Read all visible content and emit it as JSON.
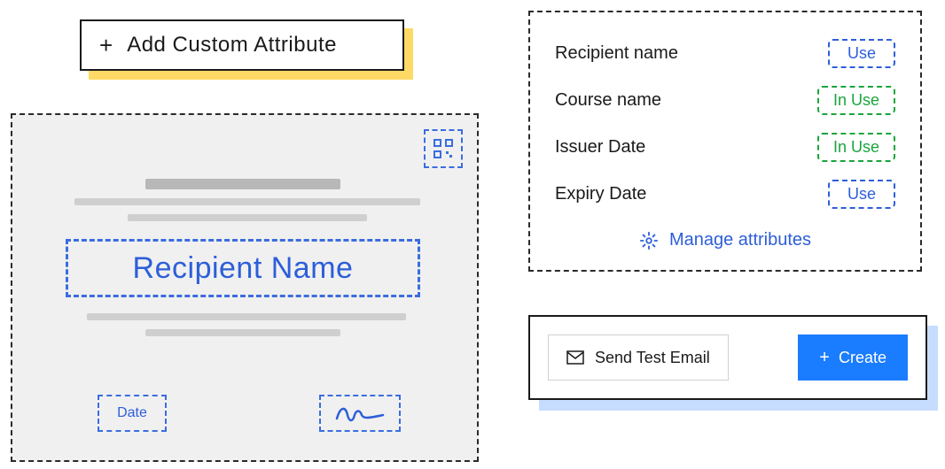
{
  "add_custom_attribute": {
    "label": "Add Custom Attribute"
  },
  "certificate": {
    "recipient_placeholder": "Recipient Name",
    "date_placeholder": "Date"
  },
  "attributes": {
    "rows": [
      {
        "name": "Recipient name",
        "status": "Use",
        "status_kind": "use"
      },
      {
        "name": "Course name",
        "status": "In Use",
        "status_kind": "inuse"
      },
      {
        "name": "Issuer Date",
        "status": "In Use",
        "status_kind": "inuse"
      },
      {
        "name": "Expiry Date",
        "status": "Use",
        "status_kind": "use"
      }
    ],
    "manage_label": "Manage attributes"
  },
  "actions": {
    "send_test_label": "Send Test Email",
    "create_label": "Create"
  }
}
